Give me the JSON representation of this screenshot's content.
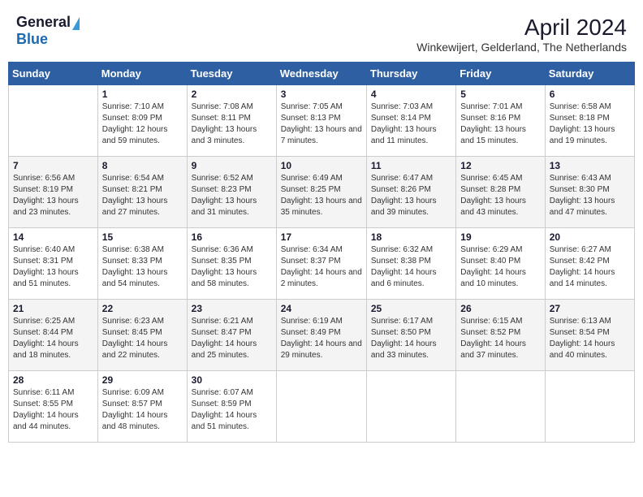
{
  "header": {
    "logo_general": "General",
    "logo_blue": "Blue",
    "month_year": "April 2024",
    "location": "Winkewijert, Gelderland, The Netherlands"
  },
  "weekdays": [
    "Sunday",
    "Monday",
    "Tuesday",
    "Wednesday",
    "Thursday",
    "Friday",
    "Saturday"
  ],
  "weeks": [
    [
      {
        "day": "",
        "sunrise": "",
        "sunset": "",
        "daylight": ""
      },
      {
        "day": "1",
        "sunrise": "Sunrise: 7:10 AM",
        "sunset": "Sunset: 8:09 PM",
        "daylight": "Daylight: 12 hours and 59 minutes."
      },
      {
        "day": "2",
        "sunrise": "Sunrise: 7:08 AM",
        "sunset": "Sunset: 8:11 PM",
        "daylight": "Daylight: 13 hours and 3 minutes."
      },
      {
        "day": "3",
        "sunrise": "Sunrise: 7:05 AM",
        "sunset": "Sunset: 8:13 PM",
        "daylight": "Daylight: 13 hours and 7 minutes."
      },
      {
        "day": "4",
        "sunrise": "Sunrise: 7:03 AM",
        "sunset": "Sunset: 8:14 PM",
        "daylight": "Daylight: 13 hours and 11 minutes."
      },
      {
        "day": "5",
        "sunrise": "Sunrise: 7:01 AM",
        "sunset": "Sunset: 8:16 PM",
        "daylight": "Daylight: 13 hours and 15 minutes."
      },
      {
        "day": "6",
        "sunrise": "Sunrise: 6:58 AM",
        "sunset": "Sunset: 8:18 PM",
        "daylight": "Daylight: 13 hours and 19 minutes."
      }
    ],
    [
      {
        "day": "7",
        "sunrise": "Sunrise: 6:56 AM",
        "sunset": "Sunset: 8:19 PM",
        "daylight": "Daylight: 13 hours and 23 minutes."
      },
      {
        "day": "8",
        "sunrise": "Sunrise: 6:54 AM",
        "sunset": "Sunset: 8:21 PM",
        "daylight": "Daylight: 13 hours and 27 minutes."
      },
      {
        "day": "9",
        "sunrise": "Sunrise: 6:52 AM",
        "sunset": "Sunset: 8:23 PM",
        "daylight": "Daylight: 13 hours and 31 minutes."
      },
      {
        "day": "10",
        "sunrise": "Sunrise: 6:49 AM",
        "sunset": "Sunset: 8:25 PM",
        "daylight": "Daylight: 13 hours and 35 minutes."
      },
      {
        "day": "11",
        "sunrise": "Sunrise: 6:47 AM",
        "sunset": "Sunset: 8:26 PM",
        "daylight": "Daylight: 13 hours and 39 minutes."
      },
      {
        "day": "12",
        "sunrise": "Sunrise: 6:45 AM",
        "sunset": "Sunset: 8:28 PM",
        "daylight": "Daylight: 13 hours and 43 minutes."
      },
      {
        "day": "13",
        "sunrise": "Sunrise: 6:43 AM",
        "sunset": "Sunset: 8:30 PM",
        "daylight": "Daylight: 13 hours and 47 minutes."
      }
    ],
    [
      {
        "day": "14",
        "sunrise": "Sunrise: 6:40 AM",
        "sunset": "Sunset: 8:31 PM",
        "daylight": "Daylight: 13 hours and 51 minutes."
      },
      {
        "day": "15",
        "sunrise": "Sunrise: 6:38 AM",
        "sunset": "Sunset: 8:33 PM",
        "daylight": "Daylight: 13 hours and 54 minutes."
      },
      {
        "day": "16",
        "sunrise": "Sunrise: 6:36 AM",
        "sunset": "Sunset: 8:35 PM",
        "daylight": "Daylight: 13 hours and 58 minutes."
      },
      {
        "day": "17",
        "sunrise": "Sunrise: 6:34 AM",
        "sunset": "Sunset: 8:37 PM",
        "daylight": "Daylight: 14 hours and 2 minutes."
      },
      {
        "day": "18",
        "sunrise": "Sunrise: 6:32 AM",
        "sunset": "Sunset: 8:38 PM",
        "daylight": "Daylight: 14 hours and 6 minutes."
      },
      {
        "day": "19",
        "sunrise": "Sunrise: 6:29 AM",
        "sunset": "Sunset: 8:40 PM",
        "daylight": "Daylight: 14 hours and 10 minutes."
      },
      {
        "day": "20",
        "sunrise": "Sunrise: 6:27 AM",
        "sunset": "Sunset: 8:42 PM",
        "daylight": "Daylight: 14 hours and 14 minutes."
      }
    ],
    [
      {
        "day": "21",
        "sunrise": "Sunrise: 6:25 AM",
        "sunset": "Sunset: 8:44 PM",
        "daylight": "Daylight: 14 hours and 18 minutes."
      },
      {
        "day": "22",
        "sunrise": "Sunrise: 6:23 AM",
        "sunset": "Sunset: 8:45 PM",
        "daylight": "Daylight: 14 hours and 22 minutes."
      },
      {
        "day": "23",
        "sunrise": "Sunrise: 6:21 AM",
        "sunset": "Sunset: 8:47 PM",
        "daylight": "Daylight: 14 hours and 25 minutes."
      },
      {
        "day": "24",
        "sunrise": "Sunrise: 6:19 AM",
        "sunset": "Sunset: 8:49 PM",
        "daylight": "Daylight: 14 hours and 29 minutes."
      },
      {
        "day": "25",
        "sunrise": "Sunrise: 6:17 AM",
        "sunset": "Sunset: 8:50 PM",
        "daylight": "Daylight: 14 hours and 33 minutes."
      },
      {
        "day": "26",
        "sunrise": "Sunrise: 6:15 AM",
        "sunset": "Sunset: 8:52 PM",
        "daylight": "Daylight: 14 hours and 37 minutes."
      },
      {
        "day": "27",
        "sunrise": "Sunrise: 6:13 AM",
        "sunset": "Sunset: 8:54 PM",
        "daylight": "Daylight: 14 hours and 40 minutes."
      }
    ],
    [
      {
        "day": "28",
        "sunrise": "Sunrise: 6:11 AM",
        "sunset": "Sunset: 8:55 PM",
        "daylight": "Daylight: 14 hours and 44 minutes."
      },
      {
        "day": "29",
        "sunrise": "Sunrise: 6:09 AM",
        "sunset": "Sunset: 8:57 PM",
        "daylight": "Daylight: 14 hours and 48 minutes."
      },
      {
        "day": "30",
        "sunrise": "Sunrise: 6:07 AM",
        "sunset": "Sunset: 8:59 PM",
        "daylight": "Daylight: 14 hours and 51 minutes."
      },
      {
        "day": "",
        "sunrise": "",
        "sunset": "",
        "daylight": ""
      },
      {
        "day": "",
        "sunrise": "",
        "sunset": "",
        "daylight": ""
      },
      {
        "day": "",
        "sunrise": "",
        "sunset": "",
        "daylight": ""
      },
      {
        "day": "",
        "sunrise": "",
        "sunset": "",
        "daylight": ""
      }
    ]
  ]
}
